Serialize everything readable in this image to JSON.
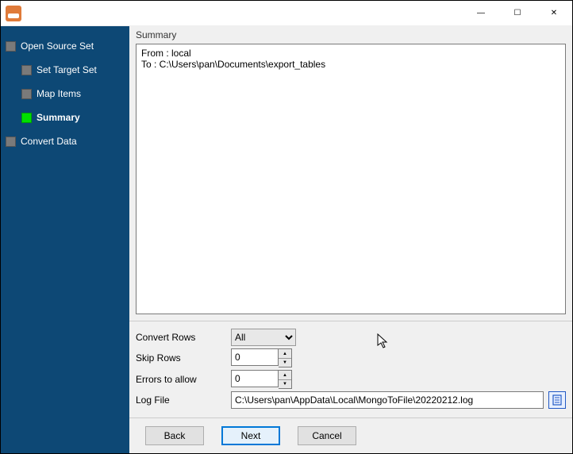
{
  "sidebar": {
    "items": [
      {
        "label": "Open Source Set"
      },
      {
        "label": "Set Target Set"
      },
      {
        "label": "Map Items"
      },
      {
        "label": "Summary"
      },
      {
        "label": "Convert Data"
      }
    ],
    "active_index": 3
  },
  "panel": {
    "title": "Summary",
    "summary_text": "From : local\nTo : C:\\Users\\pan\\Documents\\export_tables"
  },
  "options": {
    "convert_rows_label": "Convert Rows",
    "convert_rows_value": "All",
    "skip_rows_label": "Skip Rows",
    "skip_rows_value": "0",
    "errors_label": "Errors to allow",
    "errors_value": "0",
    "log_file_label": "Log File",
    "log_file_value": "C:\\Users\\pan\\AppData\\Local\\MongoToFile\\20220212.log"
  },
  "buttons": {
    "back": "Back",
    "next": "Next",
    "cancel": "Cancel"
  }
}
